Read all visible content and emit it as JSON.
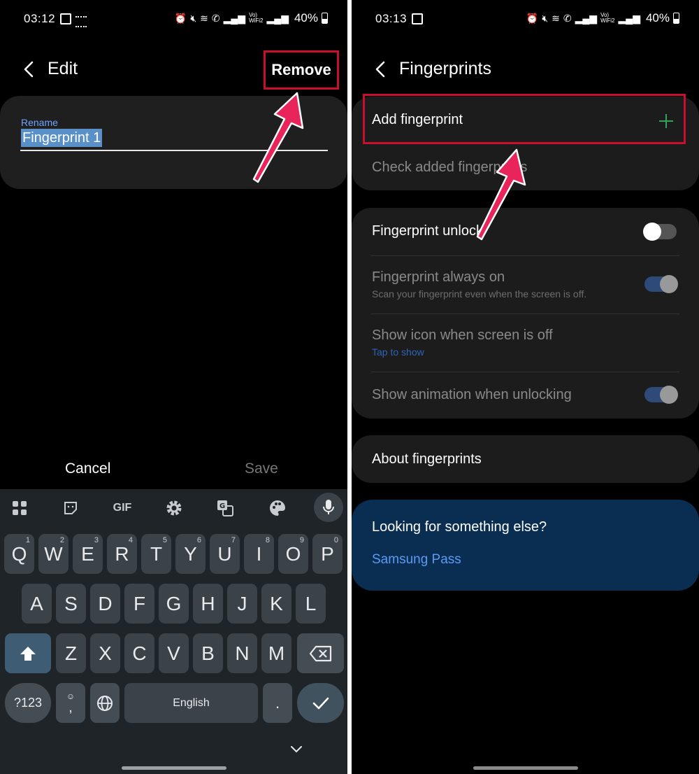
{
  "left_screen": {
    "status": {
      "time": "03:12",
      "battery": "40%"
    },
    "header": {
      "title": "Edit",
      "remove_label": "Remove"
    },
    "rename": {
      "label": "Rename",
      "value": "Fingerprint 1"
    },
    "actions": {
      "cancel_label": "Cancel",
      "save_label": "Save"
    },
    "keyboard": {
      "toolbar": [
        "apps-grid-icon",
        "sticker-icon",
        "GIF",
        "gear-icon",
        "translate-icon",
        "palette-icon",
        "mic-icon"
      ],
      "row1": [
        {
          "key": "Q",
          "hint": "1"
        },
        {
          "key": "W",
          "hint": "2"
        },
        {
          "key": "E",
          "hint": "3"
        },
        {
          "key": "R",
          "hint": "4"
        },
        {
          "key": "T",
          "hint": "5"
        },
        {
          "key": "Y",
          "hint": "6"
        },
        {
          "key": "U",
          "hint": "7"
        },
        {
          "key": "I",
          "hint": "8"
        },
        {
          "key": "O",
          "hint": "9"
        },
        {
          "key": "P",
          "hint": "0"
        }
      ],
      "row2": [
        "A",
        "S",
        "D",
        "F",
        "G",
        "H",
        "J",
        "K",
        "L"
      ],
      "row3": [
        "Z",
        "X",
        "C",
        "V",
        "B",
        "N",
        "M"
      ],
      "symbols_label": "?123",
      "emoji_comma": ",",
      "space_label": "English",
      "period_label": "."
    }
  },
  "right_screen": {
    "status": {
      "time": "03:13",
      "battery": "40%"
    },
    "header": {
      "title": "Fingerprints"
    },
    "fingerprint_card": {
      "add_label": "Add fingerprint",
      "check_label": "Check added fingerprints"
    },
    "settings": [
      {
        "title": "Fingerprint unlock",
        "subtitle": "",
        "toggle": "off"
      },
      {
        "title": "Fingerprint always on",
        "subtitle": "Scan your fingerprint even when the screen is off.",
        "toggle": "on"
      },
      {
        "title": "Show icon when screen is off",
        "subtitle": "Tap to show",
        "toggle": null
      },
      {
        "title": "Show animation when unlocking",
        "subtitle": "",
        "toggle": "on"
      }
    ],
    "about_label": "About fingerprints",
    "suggestion": {
      "title": "Looking for something else?",
      "link": "Samsung Pass"
    }
  },
  "colors": {
    "highlight_box": "#c8102e",
    "annotation_arrow": "#e8245a",
    "link_blue": "#5b9bf5",
    "add_plus": "#2fa55a"
  }
}
